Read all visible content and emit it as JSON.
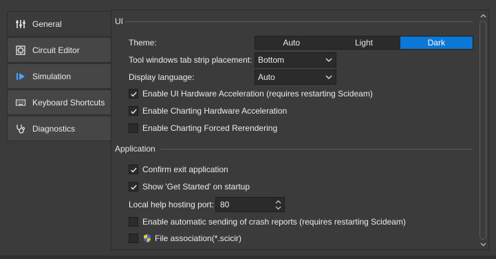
{
  "nav": {
    "items": [
      {
        "label": "General",
        "icon": "sliders-icon"
      },
      {
        "label": "Circuit Editor",
        "icon": "circuit-board-icon"
      },
      {
        "label": "Simulation",
        "icon": "play-step-icon"
      },
      {
        "label": "Keyboard Shortcuts",
        "icon": "keyboard-icon"
      },
      {
        "label": "Diagnostics",
        "icon": "stethoscope-icon"
      }
    ],
    "active": "General"
  },
  "ui_section": {
    "title": "UI",
    "theme_label": "Theme:",
    "theme_options": [
      "Auto",
      "Light",
      "Dark"
    ],
    "theme_selected": "Dark",
    "tab_strip_label": "Tool windows tab strip placement:",
    "tab_strip_value": "Bottom",
    "language_label": "Display language:",
    "language_value": "Auto",
    "checks": [
      {
        "label": "Enable UI Hardware Acceleration (requires restarting Scideam)",
        "checked": true
      },
      {
        "label": "Enable Charting Hardware Acceleration",
        "checked": true
      },
      {
        "label": "Enable Charting Forced Rerendering",
        "checked": false
      }
    ]
  },
  "app_section": {
    "title": "Application",
    "checks": [
      {
        "label": "Confirm exit application",
        "checked": true
      },
      {
        "label": "Show 'Get Started' on startup",
        "checked": true
      }
    ],
    "port_label": "Local help hosting port:",
    "port_value": "80",
    "crash_label": "Enable automatic sending of crash reports (requires restarting Scideam)",
    "crash_checked": false,
    "assoc_label": "File association(*.scicir)",
    "assoc_checked": false
  },
  "colors": {
    "accent": "#0a78d4",
    "background": "#3b3b3b",
    "field": "#2b2b2b"
  }
}
